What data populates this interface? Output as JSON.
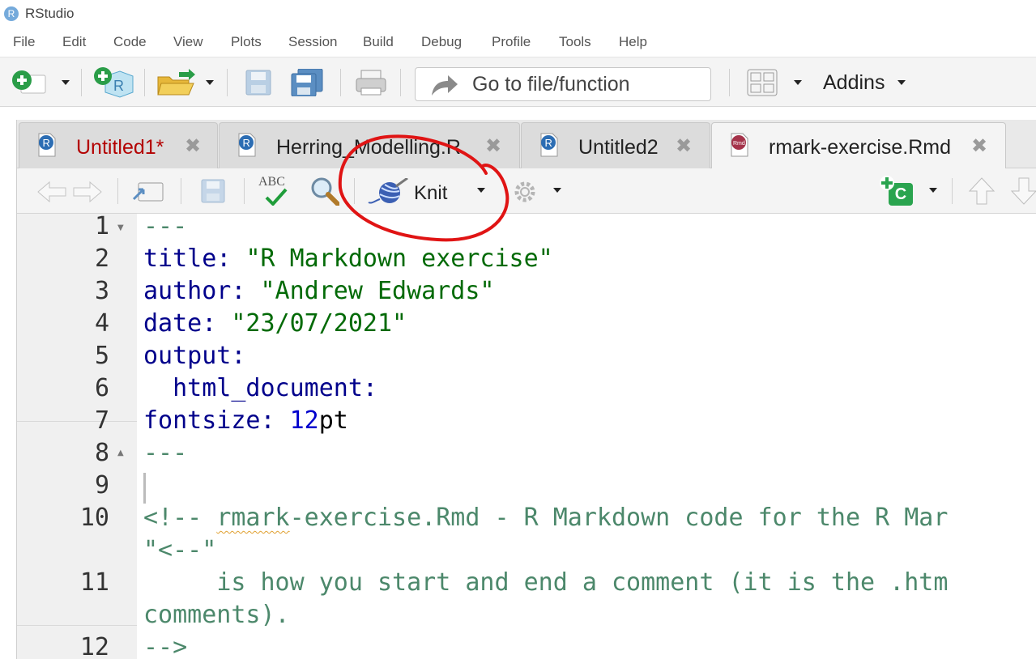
{
  "app": {
    "title": "RStudio",
    "logo_letter": "R"
  },
  "menu": [
    "File",
    "Edit",
    "Code",
    "View",
    "Plots",
    "Session",
    "Build",
    "Debug",
    "Profile",
    "Tools",
    "Help"
  ],
  "toolbar": {
    "goto_placeholder": "Go to file/function",
    "addins_label": "Addins"
  },
  "tabs": [
    {
      "label": "Untitled1*",
      "icon": "r-script-icon",
      "modified": true,
      "active": false
    },
    {
      "label": "Herring_Modelling.R",
      "icon": "r-script-icon",
      "modified": false,
      "active": false
    },
    {
      "label": "Untitled2",
      "icon": "r-script-icon",
      "modified": false,
      "active": false
    },
    {
      "label": "rmark-exercise.Rmd",
      "icon": "rmd-file-icon",
      "modified": false,
      "active": true
    }
  ],
  "tab_close_glyph": "✖",
  "editor_toolbar": {
    "spellcheck_label": "ABC",
    "knit_label": "Knit",
    "insert_chunk_label": "C"
  },
  "line_numbers": [
    "1",
    "2",
    "3",
    "4",
    "5",
    "6",
    "7",
    "8",
    "9",
    "10",
    "11",
    "12"
  ],
  "code": {
    "l1": "---",
    "l2_key": "title:",
    "l2_val": "\"R Markdown exercise\"",
    "l3_key": "author:",
    "l3_val": "\"Andrew Edwards\"",
    "l4_key": "date:",
    "l4_val": "\"23/07/2021\"",
    "l5_key": "output:",
    "l6_key": "html_document:",
    "l7_key": "fontsize:",
    "l7_num": "12",
    "l7_unit": "pt",
    "l8": "---",
    "l10_a": "<!-- ",
    "l10_b": "rmark",
    "l10_c": "-exercise.Rmd - R Markdown code for the R Mar",
    "l10_wrap": "\"<--\"",
    "l11": "is how you start and end a comment (it is the .htm",
    "l11_wrap": "comments).",
    "l12": "-->"
  },
  "colors": {
    "keyword": "#00008b",
    "string": "#036a07",
    "comment": "#4c886b",
    "modified_tab": "#b30000",
    "annotation": "#e01414"
  }
}
